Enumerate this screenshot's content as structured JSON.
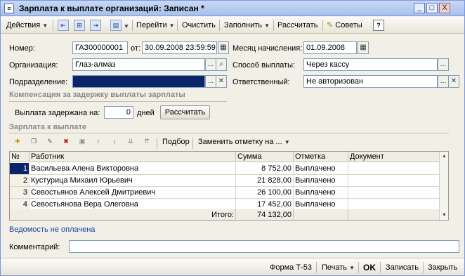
{
  "window": {
    "title": "Зарплата к выплате организаций: Записан *",
    "controls": {
      "minimize": "_",
      "maximize": "□",
      "close": "X"
    }
  },
  "toolbar": {
    "actions_label": "Действия",
    "goto_label": "Перейти",
    "clear_label": "Очистить",
    "fill_label": "Заполнить",
    "calculate_label": "Рассчитать",
    "tips_label": "Советы",
    "help_label": "?"
  },
  "header": {
    "number_label": "Номер:",
    "number_value": "ГАЗ00000001",
    "date_label": "от:",
    "date_value": "30.09.2008 23:59:59",
    "month_label": "Месяц начисления:",
    "month_value": "01.09.2008",
    "org_label": "Организация:",
    "org_value": "Глаз-алмаз",
    "payment_method_label": "Способ выплаты:",
    "payment_method_value": "Через кассу",
    "division_label": "Подразделение:",
    "division_value": "",
    "responsible_label": "Ответственный:",
    "responsible_value": "Не авторизован"
  },
  "compensation": {
    "section_title": "Компенсация за задержку выплаты зарплаты",
    "delay_label": "Выплата задержана на:",
    "delay_value": "0",
    "days_label": "дней",
    "calc_button": "Рассчитать"
  },
  "payroll": {
    "section_title": "Зарплата к выплате",
    "selection_label": "Подбор",
    "replace_mark_label": "Заменить отметку на ...",
    "columns": [
      "№",
      "Работник",
      "Сумма",
      "Отметка",
      "Документ"
    ],
    "rows": [
      {
        "n": "1",
        "employee": "Васильева Алена Викторовна",
        "amount": "8 752,00",
        "mark": "Выплачено",
        "doc": ""
      },
      {
        "n": "2",
        "employee": "Кустурица Михаил Юрьевич",
        "amount": "21 828,00",
        "mark": "Выплачено",
        "doc": ""
      },
      {
        "n": "3",
        "employee": "Севостьянов Алексей Дмитриевич",
        "amount": "26 100,00",
        "mark": "Выплачено",
        "doc": ""
      },
      {
        "n": "4",
        "employee": "Севостьянова Вера Олеговна",
        "amount": "17 452,00",
        "mark": "Выплачено",
        "doc": ""
      }
    ],
    "total_label": "Итого:",
    "total_value": "74 132,00"
  },
  "footer": {
    "statement_link": "Ведомость не оплачена",
    "comment_label": "Комментарий:",
    "comment_value": ""
  },
  "statusbar": {
    "form_label": "Форма Т-53",
    "print_label": "Печать",
    "ok_label": "OK",
    "save_label": "Записать",
    "close_label": "Закрыть"
  }
}
